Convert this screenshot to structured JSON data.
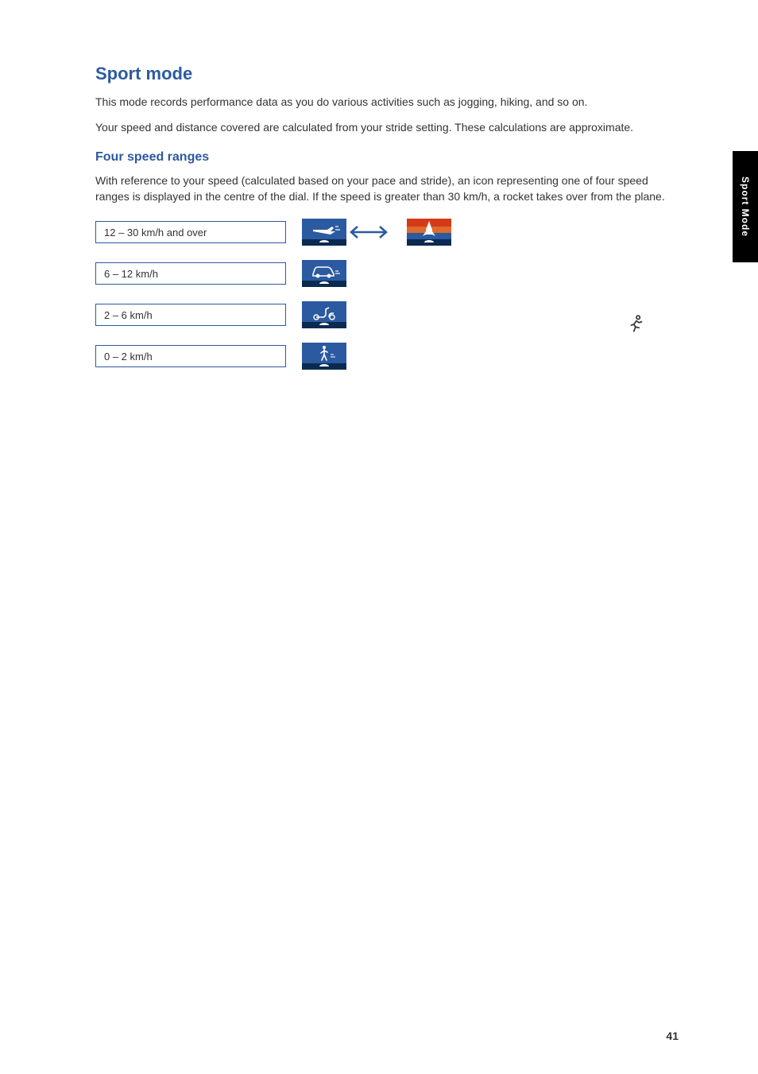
{
  "sideTab": "Sport Mode",
  "heading": "Sport mode",
  "para1": "This mode records performance data as you do various activities such as jogging, hiking, and so on.",
  "para2": "Your speed and distance covered are calculated from your stride setting. These calculations are approximate.",
  "subheading": "Four speed ranges",
  "para3": "With reference to your speed (calculated based on your pace and stride), an icon representing one of four speed ranges is displayed in the centre of the dial. If the speed is greater than 30 km/h, a rocket takes over from the plane.",
  "rows": [
    {
      "label": "12 – 30 km/h and over",
      "icon": "plane-rocket"
    },
    {
      "label": "6 – 12 km/h",
      "icon": "car"
    },
    {
      "label": "2 – 6 km/h",
      "icon": "scooter"
    },
    {
      "label": "0 – 2 km/h",
      "icon": "walker"
    }
  ],
  "footer": {
    "leftTitle": "",
    "centerTitle": "",
    "pageNumber": "41"
  }
}
